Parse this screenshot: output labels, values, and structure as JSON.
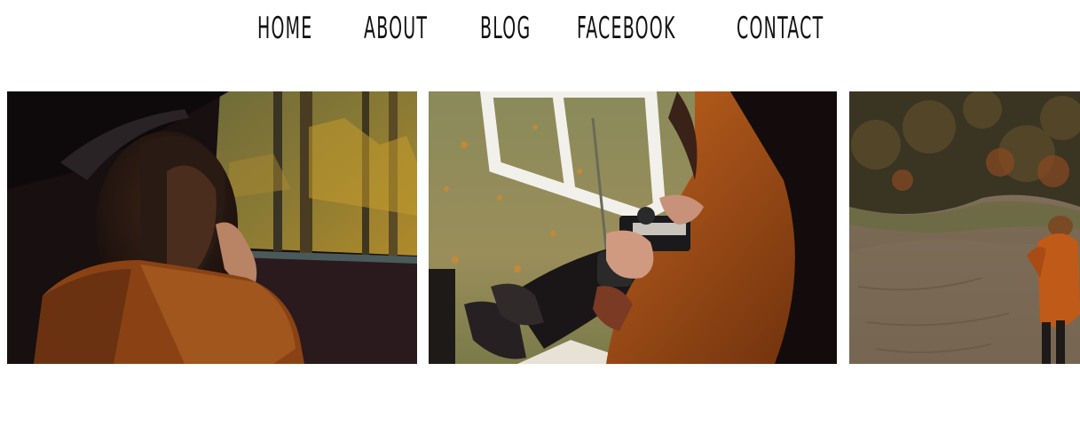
{
  "nav": {
    "items": [
      {
        "label": "HOME"
      },
      {
        "label": "ABOUT"
      },
      {
        "label": "BLOG"
      },
      {
        "label": "FACEBOOK"
      },
      {
        "label": "CONTACT"
      }
    ]
  },
  "gallery": {
    "photos": [
      {
        "subject": "woman-in-car-window"
      },
      {
        "subject": "hands-holding-camera"
      },
      {
        "subject": "woman-walking-field"
      }
    ]
  },
  "colors": {
    "background": "#ffffff",
    "nav_text": "#111111",
    "coat_orange": "#9a4a14"
  }
}
